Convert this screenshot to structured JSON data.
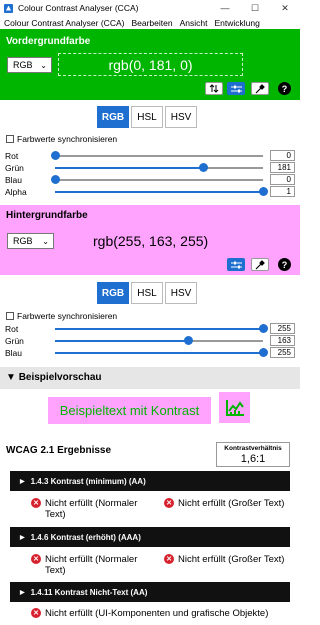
{
  "window": {
    "title": "Colour Contrast Analyser (CCA)",
    "minimize": "—",
    "maximize": "☐",
    "close": "✕"
  },
  "menu": [
    "Colour Contrast Analyser (CCA)",
    "Bearbeiten",
    "Ansicht",
    "Entwicklung"
  ],
  "foreground": {
    "title": "Vordergrundfarbe",
    "format": "RGB",
    "value": "rgb(0, 181, 0)",
    "color": "#00b500",
    "tabs": [
      "RGB",
      "HSL",
      "HSV"
    ],
    "active_tab": "RGB",
    "sync_label": "Farbwerte synchronisieren",
    "sliders": [
      {
        "label": "Rot",
        "value": "0",
        "fraction": 0.0
      },
      {
        "label": "Grün",
        "value": "181",
        "fraction": 0.71
      },
      {
        "label": "Blau",
        "value": "0",
        "fraction": 0.0
      },
      {
        "label": "Alpha",
        "value": "1",
        "fraction": 1.0
      }
    ]
  },
  "background": {
    "title": "Hintergrundfarbe",
    "format": "RGB",
    "value": "rgb(255, 163, 255)",
    "color": "#ffa3ff",
    "tabs": [
      "RGB",
      "HSL",
      "HSV"
    ],
    "active_tab": "RGB",
    "sync_label": "Farbwerte synchronisieren",
    "sliders": [
      {
        "label": "Rot",
        "value": "255",
        "fraction": 1.0
      },
      {
        "label": "Grün",
        "value": "163",
        "fraction": 0.64
      },
      {
        "label": "Blau",
        "value": "255",
        "fraction": 1.0
      }
    ]
  },
  "preview": {
    "title": "Beispielvorschau",
    "sample_text": "Beispieltext mit Kontrast"
  },
  "results": {
    "title": "WCAG 2.1 Ergebnisse",
    "ratio_label": "Kontrastverhältnis",
    "ratio_value": "1,6:1",
    "criteria": [
      {
        "label": "1.4.3 Kontrast (minimum) (AA)",
        "results": [
          "Nicht erfüllt (Normaler Text)",
          "Nicht erfüllt (Großer Text)"
        ]
      },
      {
        "label": "1.4.6 Kontrast (erhöht) (AAA)",
        "results": [
          "Nicht erfüllt (Normaler Text)",
          "Nicht erfüllt (Großer Text)"
        ]
      },
      {
        "label": "1.4.11 Kontrast Nicht-Text (AA)",
        "results": [
          "Nicht erfüllt (UI-Komponenten und grafische Objekte)"
        ]
      }
    ]
  },
  "icons": {
    "swap": "swap-icon",
    "sliders": "sliders-icon",
    "picker": "eyedropper-icon",
    "help": "help-icon",
    "fail": "fail-icon",
    "chart": "contrast-chart-icon"
  }
}
